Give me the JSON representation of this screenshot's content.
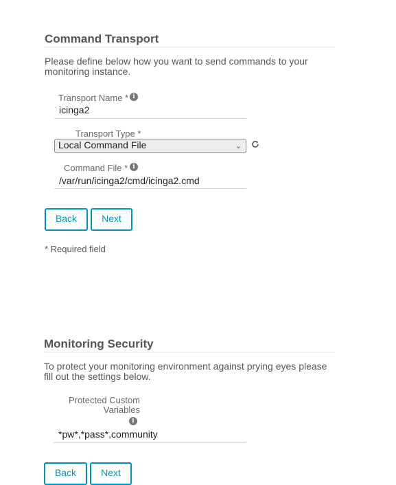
{
  "command_transport": {
    "title": "Command Transport",
    "description": "Please define below how you want to send commands to your monitoring instance.",
    "transport_name": {
      "label": "Transport Name *",
      "value": "icinga2"
    },
    "transport_type": {
      "label": "Transport Type *",
      "value": "Local Command File"
    },
    "command_file": {
      "label": "Command File *",
      "value": "/var/run/icinga2/cmd/icinga2.cmd"
    },
    "buttons": {
      "back": "Back",
      "next": "Next"
    },
    "required_note": "* Required field"
  },
  "monitoring_security": {
    "title": "Monitoring Security",
    "description": "To protect your monitoring environment against prying eyes please fill out the settings below.",
    "protected_vars": {
      "label_line1": "Protected Custom",
      "label_line2": "Variables",
      "value": "*pw*,*pass*,community"
    },
    "buttons": {
      "back": "Back",
      "next": "Next"
    }
  },
  "icons": {
    "info": "info-icon",
    "refresh": "refresh-icon",
    "dropdown": "chevron-down-icon"
  },
  "colors": {
    "accent": "#0095bf",
    "title": "#555555"
  }
}
